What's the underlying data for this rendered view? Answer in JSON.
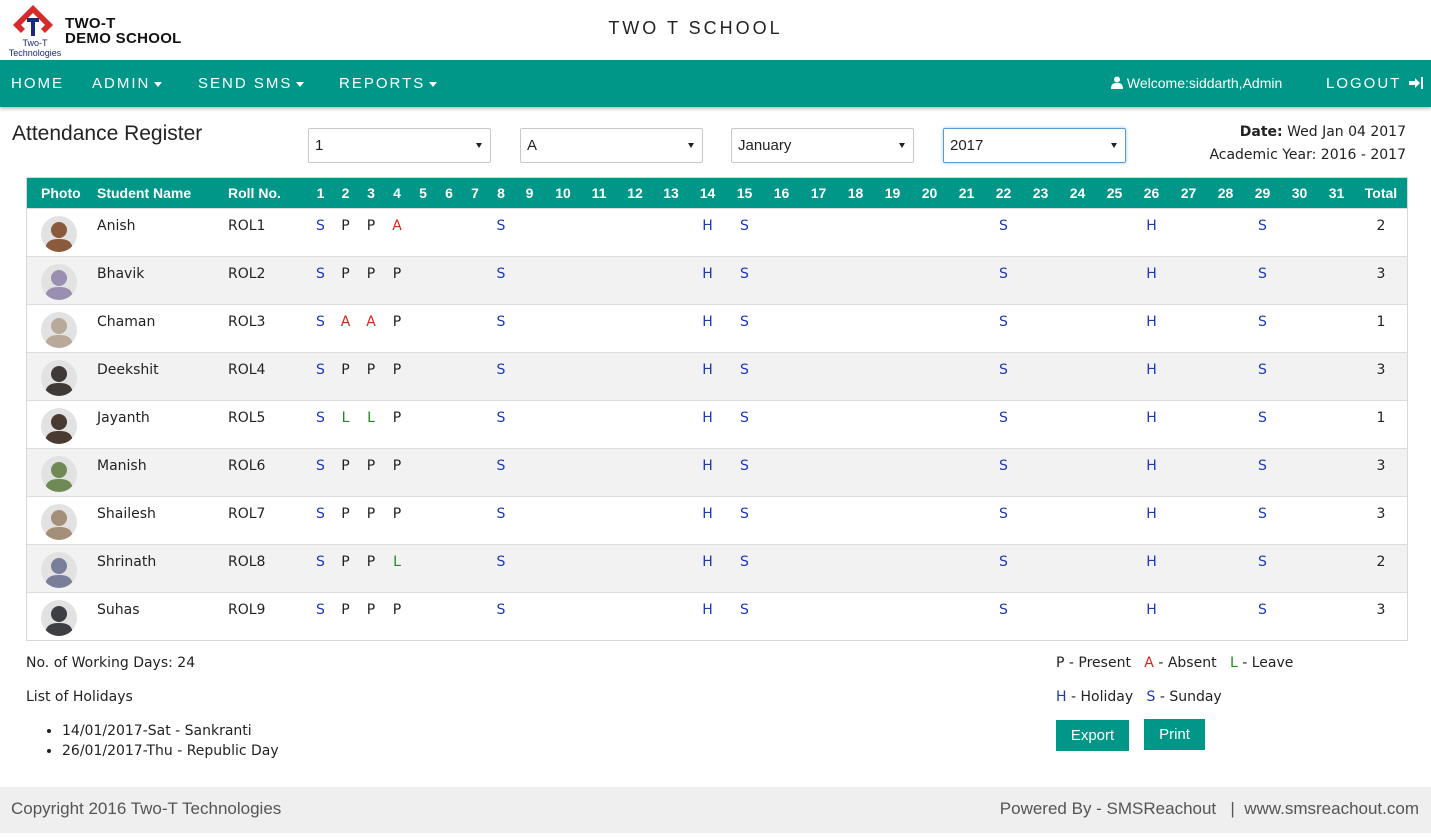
{
  "header": {
    "logo_caption": "Two-T Technologies",
    "brand_line1": "TWO-T",
    "brand_line2": "DEMO SCHOOL",
    "school_title": "TWO T SCHOOL"
  },
  "nav": {
    "home": "HOME",
    "admin": "ADMIN",
    "send_sms": "SEND SMS",
    "reports": "REPORTS",
    "welcome": "Welcome:siddarth,Admin",
    "logout": "LOGOUT",
    "user_icon": "user-icon",
    "logout_icon": "sign-out-icon"
  },
  "page": {
    "title": "Attendance Register",
    "filters": {
      "class": "1",
      "section": "A",
      "month": "January",
      "year": "2017"
    },
    "date_label": "Date:",
    "date_value": "Wed Jan 04 2017",
    "academic_year": "Academic Year: 2016 - 2017"
  },
  "table": {
    "headers": {
      "photo": "Photo",
      "name": "Student Name",
      "roll": "Roll No.",
      "days": [
        "1",
        "2",
        "3",
        "4",
        "5",
        "6",
        "7",
        "8",
        "9",
        "10",
        "11",
        "12",
        "13",
        "14",
        "15",
        "16",
        "17",
        "18",
        "19",
        "20",
        "21",
        "22",
        "23",
        "24",
        "25",
        "26",
        "27",
        "28",
        "29",
        "30",
        "31"
      ],
      "total": "Total"
    },
    "rows": [
      {
        "name": "Anish",
        "roll": "ROL1",
        "marks": {
          "1": "S",
          "2": "P",
          "3": "P",
          "4": "A",
          "8": "S",
          "14": "H",
          "15": "S",
          "22": "S",
          "26": "H",
          "29": "S"
        },
        "total": "2",
        "avatar_color": "#8a5a3c"
      },
      {
        "name": "Bhavik",
        "roll": "ROL2",
        "marks": {
          "1": "S",
          "2": "P",
          "3": "P",
          "4": "P",
          "8": "S",
          "14": "H",
          "15": "S",
          "22": "S",
          "26": "H",
          "29": "S"
        },
        "total": "3",
        "avatar_color": "#9a8fb0"
      },
      {
        "name": "Chaman",
        "roll": "ROL3",
        "marks": {
          "1": "S",
          "2": "A",
          "3": "A",
          "4": "P",
          "8": "S",
          "14": "H",
          "15": "S",
          "22": "S",
          "26": "H",
          "29": "S"
        },
        "total": "1",
        "avatar_color": "#b8a99a"
      },
      {
        "name": "Deekshit",
        "roll": "ROL4",
        "marks": {
          "1": "S",
          "2": "P",
          "3": "P",
          "4": "P",
          "8": "S",
          "14": "H",
          "15": "S",
          "22": "S",
          "26": "H",
          "29": "S"
        },
        "total": "3",
        "avatar_color": "#3f3a38"
      },
      {
        "name": "Jayanth",
        "roll": "ROL5",
        "marks": {
          "1": "S",
          "2": "L",
          "3": "L",
          "4": "P",
          "8": "S",
          "14": "H",
          "15": "S",
          "22": "S",
          "26": "H",
          "29": "S"
        },
        "total": "1",
        "avatar_color": "#4a3b32"
      },
      {
        "name": "Manish",
        "roll": "ROL6",
        "marks": {
          "1": "S",
          "2": "P",
          "3": "P",
          "4": "P",
          "8": "S",
          "14": "H",
          "15": "S",
          "22": "S",
          "26": "H",
          "29": "S"
        },
        "total": "3",
        "avatar_color": "#6f8a55"
      },
      {
        "name": "Shailesh",
        "roll": "ROL7",
        "marks": {
          "1": "S",
          "2": "P",
          "3": "P",
          "4": "P",
          "8": "S",
          "14": "H",
          "15": "S",
          "22": "S",
          "26": "H",
          "29": "S"
        },
        "total": "3",
        "avatar_color": "#a58f7a"
      },
      {
        "name": "Shrinath",
        "roll": "ROL8",
        "marks": {
          "1": "S",
          "2": "P",
          "3": "P",
          "4": "L",
          "8": "S",
          "14": "H",
          "15": "S",
          "22": "S",
          "26": "H",
          "29": "S"
        },
        "total": "2",
        "avatar_color": "#7a7f99"
      },
      {
        "name": "Suhas",
        "roll": "ROL9",
        "marks": {
          "1": "S",
          "2": "P",
          "3": "P",
          "4": "P",
          "8": "S",
          "14": "H",
          "15": "S",
          "22": "S",
          "26": "H",
          "29": "S"
        },
        "total": "3",
        "avatar_color": "#3d3f45"
      }
    ]
  },
  "summary": {
    "working_days": "No. of Working Days: 24",
    "holidays_title": "List of Holidays",
    "holidays": [
      "14/01/2017-Sat - Sankranti",
      "26/01/2017-Thu - Republic Day"
    ]
  },
  "legend": {
    "p_code": "P",
    "p_text": "- Present",
    "a_code": "A",
    "a_text": "- Absent",
    "l_code": "L",
    "l_text": "- Leave",
    "h_code": "H",
    "h_text": "- Holiday",
    "s_code": "S",
    "s_text": "- Sunday"
  },
  "buttons": {
    "export": "Export",
    "print": "Print"
  },
  "footer": {
    "copyright": "Copyright 2016 Two-T Technologies",
    "powered": "Powered By - SMSReachout",
    "separator": "|",
    "site": "www.smsreachout.com"
  },
  "colors": {
    "accent": "#009688",
    "absent": "#d9231d",
    "leave": "#1f8a1f",
    "holiday_sunday": "#1a3bb5"
  }
}
